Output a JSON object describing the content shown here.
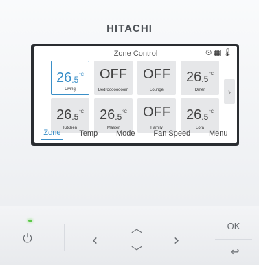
{
  "brand": "HITACHI",
  "screen": {
    "title": "Zone Control",
    "status_icons": [
      "timer-icon",
      "calendar-grid-icon",
      "thermometer-icon"
    ],
    "zones": [
      {
        "value": "26",
        "decimal": ".5",
        "unit": "°C",
        "name": "Living",
        "selected": true
      },
      {
        "value": "OFF",
        "name": "Bedroooooooom",
        "selected": false
      },
      {
        "value": "OFF",
        "name": "Lounge",
        "selected": false
      },
      {
        "value": "26",
        "decimal": ".5",
        "unit": "°C",
        "name": "Diner",
        "selected": false
      },
      {
        "value": "26",
        "decimal": ".5",
        "unit": "°C",
        "name": "Kitchen",
        "selected": false
      },
      {
        "value": "26",
        "decimal": ".5",
        "unit": "°C",
        "name": "Master",
        "selected": false
      },
      {
        "value": "OFF",
        "name": "Family",
        "selected": false
      },
      {
        "value": "26",
        "decimal": ".5",
        "unit": "°C",
        "name": "Lora",
        "selected": false
      }
    ],
    "next_arrow": "›",
    "menu": [
      {
        "label": "Zone",
        "active": true
      },
      {
        "label": "Temp",
        "active": false
      },
      {
        "label": "Mode",
        "active": false
      },
      {
        "label": "Fan Speed",
        "active": false
      },
      {
        "label": "Menu",
        "active": false
      }
    ]
  },
  "buttons": {
    "power": "⏻",
    "left": "‹",
    "right": "›",
    "up": "︿",
    "down": "﹀",
    "ok": "OK",
    "back": "↩"
  },
  "colors": {
    "accent": "#3a8fc8",
    "tile_bg": "#e6e7e9",
    "led_green": "#5dc84a"
  }
}
